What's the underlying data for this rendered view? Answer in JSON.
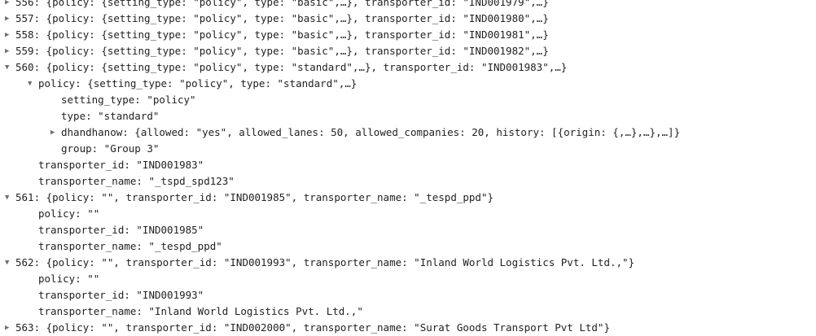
{
  "rows": [
    {
      "arrow": "▶",
      "indent": 0,
      "text": "556: {policy: {setting_type: \"policy\", type: \"basic\",…}, transporter_id: \"IND001979\",…}"
    },
    {
      "arrow": "▶",
      "indent": 0,
      "text": "557: {policy: {setting_type: \"policy\", type: \"basic\",…}, transporter_id: \"IND001980\",…}"
    },
    {
      "arrow": "▶",
      "indent": 0,
      "text": "558: {policy: {setting_type: \"policy\", type: \"basic\",…}, transporter_id: \"IND001981\",…}"
    },
    {
      "arrow": "▶",
      "indent": 0,
      "text": "559: {policy: {setting_type: \"policy\", type: \"basic\",…}, transporter_id: \"IND001982\",…}"
    },
    {
      "arrow": "▼",
      "indent": 0,
      "text": "560: {policy: {setting_type: \"policy\", type: \"standard\",…}, transporter_id: \"IND001983\",…}"
    },
    {
      "arrow": "▼",
      "indent": 1,
      "text": "policy: {setting_type: \"policy\", type: \"standard\",…}"
    },
    {
      "arrow": "",
      "indent": 2,
      "text": "setting_type: \"policy\""
    },
    {
      "arrow": "",
      "indent": 2,
      "text": "type: \"standard\""
    },
    {
      "arrow": "▶",
      "indent": 2,
      "text": "dhandhanow: {allowed: \"yes\", allowed_lanes: 50, allowed_companies: 20, history: [{origin: {,…},…},…]}"
    },
    {
      "arrow": "",
      "indent": 2,
      "text": "group: \"Group 3\""
    },
    {
      "arrow": "",
      "indent": 1,
      "text": "transporter_id: \"IND001983\""
    },
    {
      "arrow": "",
      "indent": 1,
      "text": "transporter_name: \"_tspd_spd123\""
    },
    {
      "arrow": "▼",
      "indent": 0,
      "text": "561: {policy: \"\", transporter_id: \"IND001985\", transporter_name: \"_tespd_ppd\"}"
    },
    {
      "arrow": "",
      "indent": 1,
      "text": "policy: \"\""
    },
    {
      "arrow": "",
      "indent": 1,
      "text": "transporter_id: \"IND001985\""
    },
    {
      "arrow": "",
      "indent": 1,
      "text": "transporter_name: \"_tespd_ppd\""
    },
    {
      "arrow": "▼",
      "indent": 0,
      "text": "562: {policy: \"\", transporter_id: \"IND001993\", transporter_name: \"Inland World Logistics Pvt. Ltd.,\"}"
    },
    {
      "arrow": "",
      "indent": 1,
      "text": "policy: \"\""
    },
    {
      "arrow": "",
      "indent": 1,
      "text": "transporter_id: \"IND001993\""
    },
    {
      "arrow": "",
      "indent": 1,
      "text": "transporter_name: \"Inland World Logistics Pvt. Ltd.,\""
    },
    {
      "arrow": "▶",
      "indent": 0,
      "text": "563: {policy: \"\", transporter_id: \"IND002000\", transporter_name: \"Surat Goods Transport Pvt Ltd\"}"
    }
  ]
}
